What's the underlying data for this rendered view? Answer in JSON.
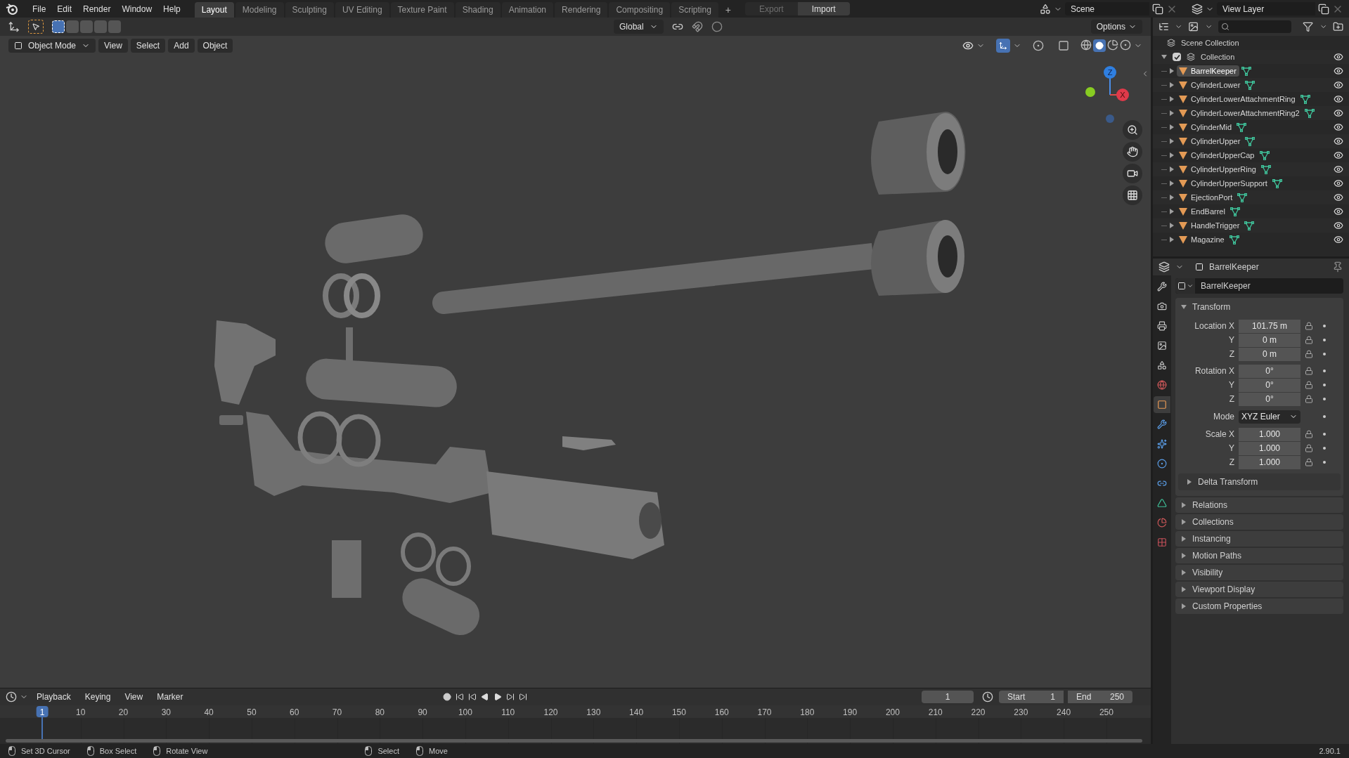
{
  "menu": [
    "File",
    "Edit",
    "Render",
    "Window",
    "Help"
  ],
  "workspaces": [
    {
      "label": "Layout",
      "selected": true
    },
    {
      "label": "Modeling",
      "selected": false
    },
    {
      "label": "Sculpting",
      "selected": false
    },
    {
      "label": "UV Editing",
      "selected": false
    },
    {
      "label": "Texture Paint",
      "selected": false
    },
    {
      "label": "Shading",
      "selected": false
    },
    {
      "label": "Animation",
      "selected": false
    },
    {
      "label": "Rendering",
      "selected": false
    },
    {
      "label": "Compositing",
      "selected": false
    },
    {
      "label": "Scripting",
      "selected": false
    }
  ],
  "add_workspace": "+",
  "export": {
    "label": "Export",
    "disabled": true
  },
  "import": {
    "label": "Import",
    "disabled": false
  },
  "scene": "Scene",
  "view_layer": "View Layer",
  "transform_orientation": "Global",
  "options": "Options",
  "mode": "Object Mode",
  "viewport_menu": [
    "View",
    "Select",
    "Add",
    "Object"
  ],
  "gizmo": {
    "z": "Z",
    "x": "X"
  },
  "outliner": {
    "root": "Scene Collection",
    "collection": {
      "label": "Collection",
      "checked": true,
      "expanded": true,
      "visible": true,
      "children": [
        {
          "label": "BarrelKeeper",
          "selected": true,
          "visible": true
        },
        {
          "label": "CylinderLower",
          "selected": false,
          "visible": true
        },
        {
          "label": "CylinderLowerAttachmentRing",
          "selected": false,
          "visible": true
        },
        {
          "label": "CylinderLowerAttachmentRing2",
          "selected": false,
          "visible": true
        },
        {
          "label": "CylinderMid",
          "selected": false,
          "visible": true
        },
        {
          "label": "CylinderUpper",
          "selected": false,
          "visible": true
        },
        {
          "label": "CylinderUpperCap",
          "selected": false,
          "visible": true
        },
        {
          "label": "CylinderUpperRing",
          "selected": false,
          "visible": true
        },
        {
          "label": "CylinderUpperSupport",
          "selected": false,
          "visible": true
        },
        {
          "label": "EjectionPort",
          "selected": false,
          "visible": true
        },
        {
          "label": "EndBarrel",
          "selected": false,
          "visible": true
        },
        {
          "label": "HandleTrigger",
          "selected": false,
          "visible": true
        },
        {
          "label": "Magazine",
          "selected": false,
          "visible": true
        }
      ]
    }
  },
  "properties": {
    "object_name": "BarrelKeeper",
    "name_field": "BarrelKeeper",
    "tabs": [
      {
        "kind": "tool",
        "selected": false
      },
      {
        "kind": "render",
        "selected": false
      },
      {
        "kind": "output",
        "selected": false
      },
      {
        "kind": "view_layer",
        "selected": false
      },
      {
        "kind": "scene",
        "selected": false
      },
      {
        "kind": "world",
        "selected": false
      },
      {
        "kind": "object",
        "selected": true
      },
      {
        "kind": "modifiers",
        "selected": false
      },
      {
        "kind": "particles",
        "selected": false
      },
      {
        "kind": "physics",
        "selected": false
      },
      {
        "kind": "constraints",
        "selected": false
      },
      {
        "kind": "data",
        "selected": false
      },
      {
        "kind": "material",
        "selected": false
      },
      {
        "kind": "texture",
        "selected": false
      }
    ],
    "transform": {
      "title": "Transform",
      "expanded": true,
      "groups": [
        {
          "kind": "vector",
          "rows": [
            {
              "label": "Location X",
              "value": "101.75 m"
            },
            {
              "label": "Y",
              "value": "0 m"
            },
            {
              "label": "Z",
              "value": "0 m"
            }
          ]
        },
        {
          "kind": "vector",
          "rows": [
            {
              "label": "Rotation X",
              "value": "0°"
            },
            {
              "label": "Y",
              "value": "0°"
            },
            {
              "label": "Z",
              "value": "0°"
            }
          ]
        },
        {
          "kind": "dropdown",
          "label": "Mode",
          "value": "XYZ Euler"
        },
        {
          "kind": "vector",
          "rows": [
            {
              "label": "Scale X",
              "value": "1.000"
            },
            {
              "label": "Y",
              "value": "1.000"
            },
            {
              "label": "Z",
              "value": "1.000"
            }
          ]
        }
      ],
      "delta": {
        "label": "Delta Transform",
        "expanded": false
      }
    },
    "panels": [
      {
        "label": "Relations",
        "expanded": false
      },
      {
        "label": "Collections",
        "expanded": false
      },
      {
        "label": "Instancing",
        "expanded": false
      },
      {
        "label": "Motion Paths",
        "expanded": false
      },
      {
        "label": "Visibility",
        "expanded": false
      },
      {
        "label": "Viewport Display",
        "expanded": false
      },
      {
        "label": "Custom Properties",
        "expanded": false
      }
    ]
  },
  "timeline": {
    "menus": [
      "Playback",
      "Keying",
      "View",
      "Marker"
    ],
    "current_frame": "1",
    "start_label": "Start",
    "start": "1",
    "end_label": "End",
    "end": "250",
    "ruler": [
      {
        "label": "1",
        "selected": true
      },
      {
        "label": "10",
        "selected": false
      },
      {
        "label": "20",
        "selected": false
      },
      {
        "label": "30",
        "selected": false
      },
      {
        "label": "40",
        "selected": false
      },
      {
        "label": "50",
        "selected": false
      },
      {
        "label": "60",
        "selected": false
      },
      {
        "label": "70",
        "selected": false
      },
      {
        "label": "80",
        "selected": false
      },
      {
        "label": "90",
        "selected": false
      },
      {
        "label": "100",
        "selected": false
      },
      {
        "label": "110",
        "selected": false
      },
      {
        "label": "120",
        "selected": false
      },
      {
        "label": "130",
        "selected": false
      },
      {
        "label": "140",
        "selected": false
      },
      {
        "label": "150",
        "selected": false
      },
      {
        "label": "160",
        "selected": false
      },
      {
        "label": "170",
        "selected": false
      },
      {
        "label": "180",
        "selected": false
      },
      {
        "label": "190",
        "selected": false
      },
      {
        "label": "200",
        "selected": false
      },
      {
        "label": "210",
        "selected": false
      },
      {
        "label": "220",
        "selected": false
      },
      {
        "label": "230",
        "selected": false
      },
      {
        "label": "240",
        "selected": false
      },
      {
        "label": "250",
        "selected": false
      }
    ]
  },
  "status_bar": {
    "items": [
      "Set 3D Cursor",
      "Box Select",
      "Rotate View",
      "Select",
      "Move"
    ],
    "version": "2.90.1"
  }
}
